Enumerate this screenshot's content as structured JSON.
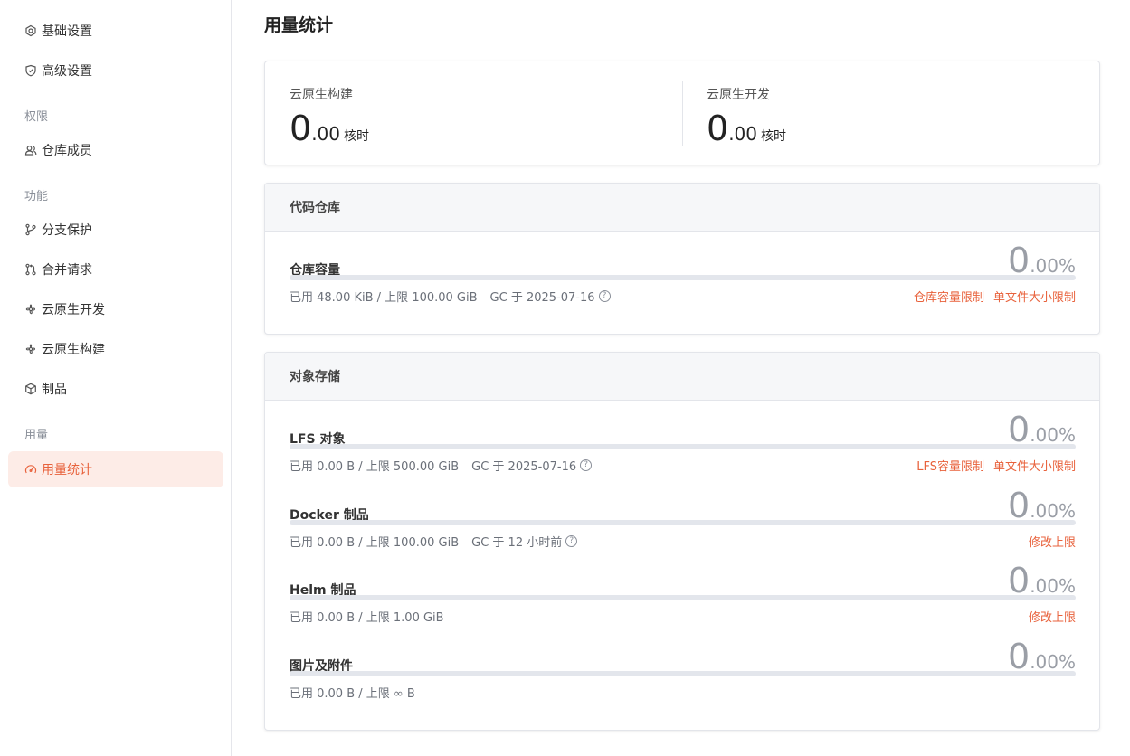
{
  "sidebar": {
    "items_top": [
      {
        "label": "基础设置",
        "icon": "settings-icon"
      },
      {
        "label": "高级设置",
        "icon": "shield-icon"
      }
    ],
    "groups": {
      "permissions": {
        "title": "权限",
        "items": [
          {
            "label": "仓库成员",
            "icon": "users-icon"
          }
        ]
      },
      "features": {
        "title": "功能",
        "items": [
          {
            "label": "分支保护",
            "icon": "branch-icon"
          },
          {
            "label": "合并请求",
            "icon": "merge-request-icon"
          },
          {
            "label": "云原生开发",
            "icon": "cloud-native-icon"
          },
          {
            "label": "云原生构建",
            "icon": "cloud-native-icon"
          },
          {
            "label": "制品",
            "icon": "package-icon"
          }
        ]
      },
      "usage": {
        "title": "用量",
        "items": [
          {
            "label": "用量统计",
            "icon": "gauge-icon",
            "active": true
          }
        ]
      }
    }
  },
  "page": {
    "title": "用量统计"
  },
  "core_hours": [
    {
      "label": "云原生构建",
      "int": "0",
      "dec": ".00",
      "unit": "核时"
    },
    {
      "label": "云原生开发",
      "int": "0",
      "dec": ".00",
      "unit": "核时"
    }
  ],
  "code_repo": {
    "title": "代码仓库",
    "items": [
      {
        "name": "仓库容量",
        "pct_int": "0",
        "pct_dec": ".00%",
        "used_fraction": 0,
        "meta": "已用 48.00 KiB / 上限 100.00 GiB",
        "gc": "GC 于 2025-07-16",
        "links": [
          "仓库容量限制",
          "单文件大小限制"
        ]
      }
    ]
  },
  "object_storage": {
    "title": "对象存储",
    "items": [
      {
        "name": "LFS 对象",
        "pct_int": "0",
        "pct_dec": ".00%",
        "used_fraction": 0,
        "meta": "已用 0.00 B / 上限 500.00 GiB",
        "gc": "GC 于 2025-07-16",
        "links": [
          "LFS容量限制",
          "单文件大小限制"
        ]
      },
      {
        "name": "Docker 制品",
        "pct_int": "0",
        "pct_dec": ".00%",
        "used_fraction": 0,
        "meta": "已用 0.00 B / 上限 100.00 GiB",
        "gc": "GC 于 12 小时前",
        "links": [
          "修改上限"
        ]
      },
      {
        "name": "Helm 制品",
        "pct_int": "0",
        "pct_dec": ".00%",
        "used_fraction": 0,
        "meta": "已用 0.00 B / 上限 1.00 GiB",
        "gc": "",
        "links": [
          "修改上限"
        ]
      },
      {
        "name": "图片及附件",
        "pct_int": "0",
        "pct_dec": ".00%",
        "used_fraction": 0,
        "meta": "已用 0.00 B / 上限 ∞ B",
        "gc": "",
        "links": []
      }
    ]
  },
  "help_icon_glyph": "?",
  "colors": {
    "accent": "#e8623c",
    "active_bg": "#fdece7"
  }
}
